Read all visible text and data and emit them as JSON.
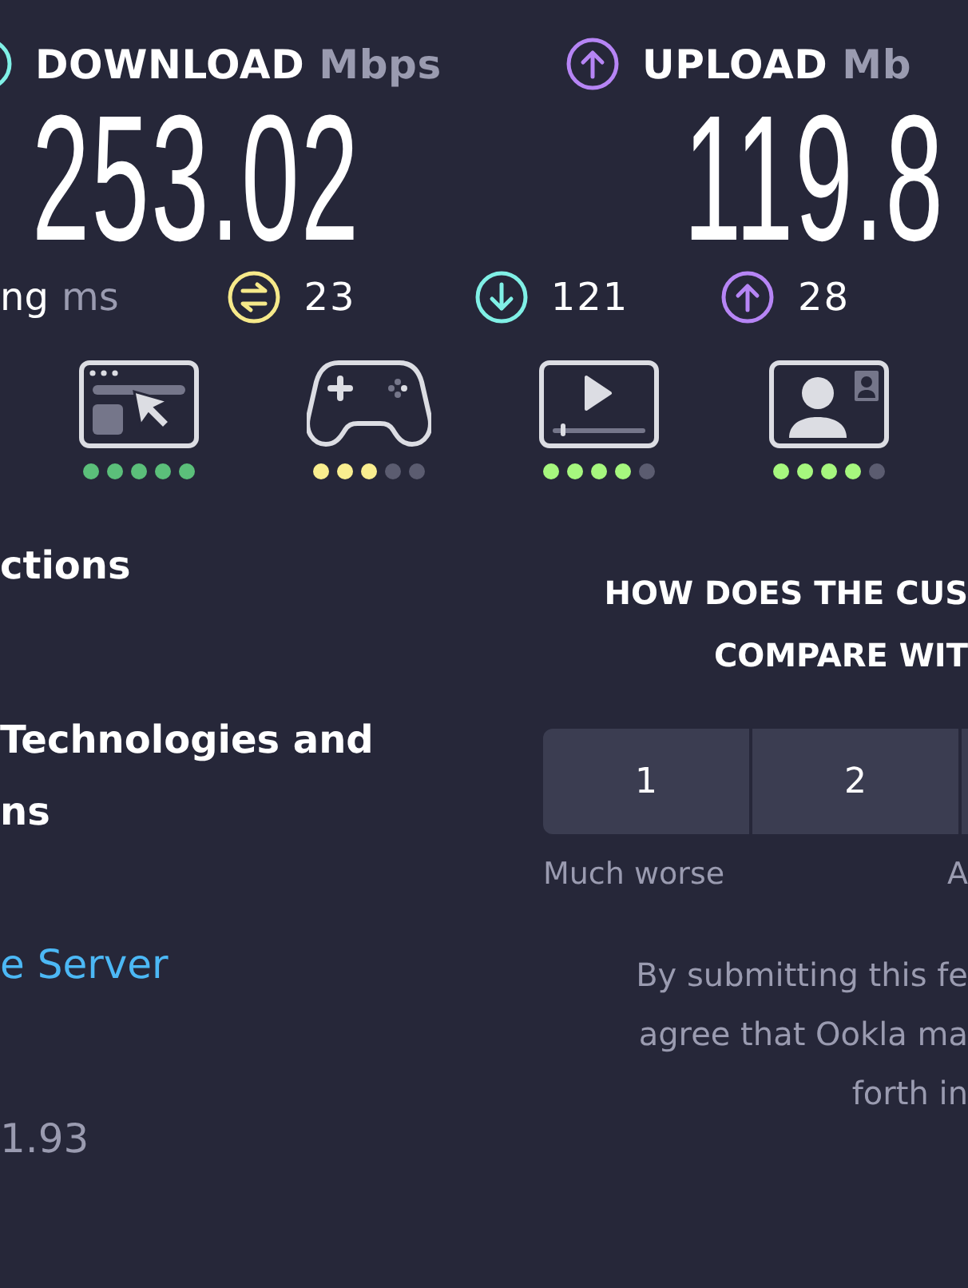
{
  "download": {
    "label": "DOWNLOAD",
    "unit": "Mbps",
    "value": "253.02"
  },
  "upload": {
    "label": "UPLOAD",
    "unit": "Mb",
    "value": "119.8"
  },
  "ping": {
    "label": "ng",
    "unit": "ms",
    "readings": [
      {
        "kind": "idle",
        "value": "23"
      },
      {
        "kind": "download",
        "value": "121"
      },
      {
        "kind": "upload",
        "value": "28"
      }
    ]
  },
  "activities": [
    {
      "kind": "browsing",
      "stars": 5
    },
    {
      "kind": "gaming",
      "stars": 3
    },
    {
      "kind": "streaming",
      "stars": 4
    },
    {
      "kind": "video-call",
      "stars": 4
    }
  ],
  "left_lines": [
    {
      "kind": "heading",
      "text": "ctions"
    },
    {
      "kind": "heading",
      "text": "Technologies and"
    },
    {
      "kind": "heading",
      "text": "ns"
    },
    {
      "kind": "link",
      "text": "e Server"
    },
    {
      "kind": "muted",
      "text": "1.93"
    }
  ],
  "survey": {
    "question_lines": [
      "HOW DOES THE CUS",
      "COMPARE WIT"
    ],
    "options": [
      {
        "kind": "full",
        "label": "1"
      },
      {
        "kind": "full",
        "label": "2"
      },
      {
        "kind": "partial"
      }
    ],
    "scale_labels": [
      "Much worse",
      "A"
    ],
    "disclaimer_lines": [
      "By submitting this fe",
      "agree that Ookla ma",
      "forth in"
    ]
  }
}
